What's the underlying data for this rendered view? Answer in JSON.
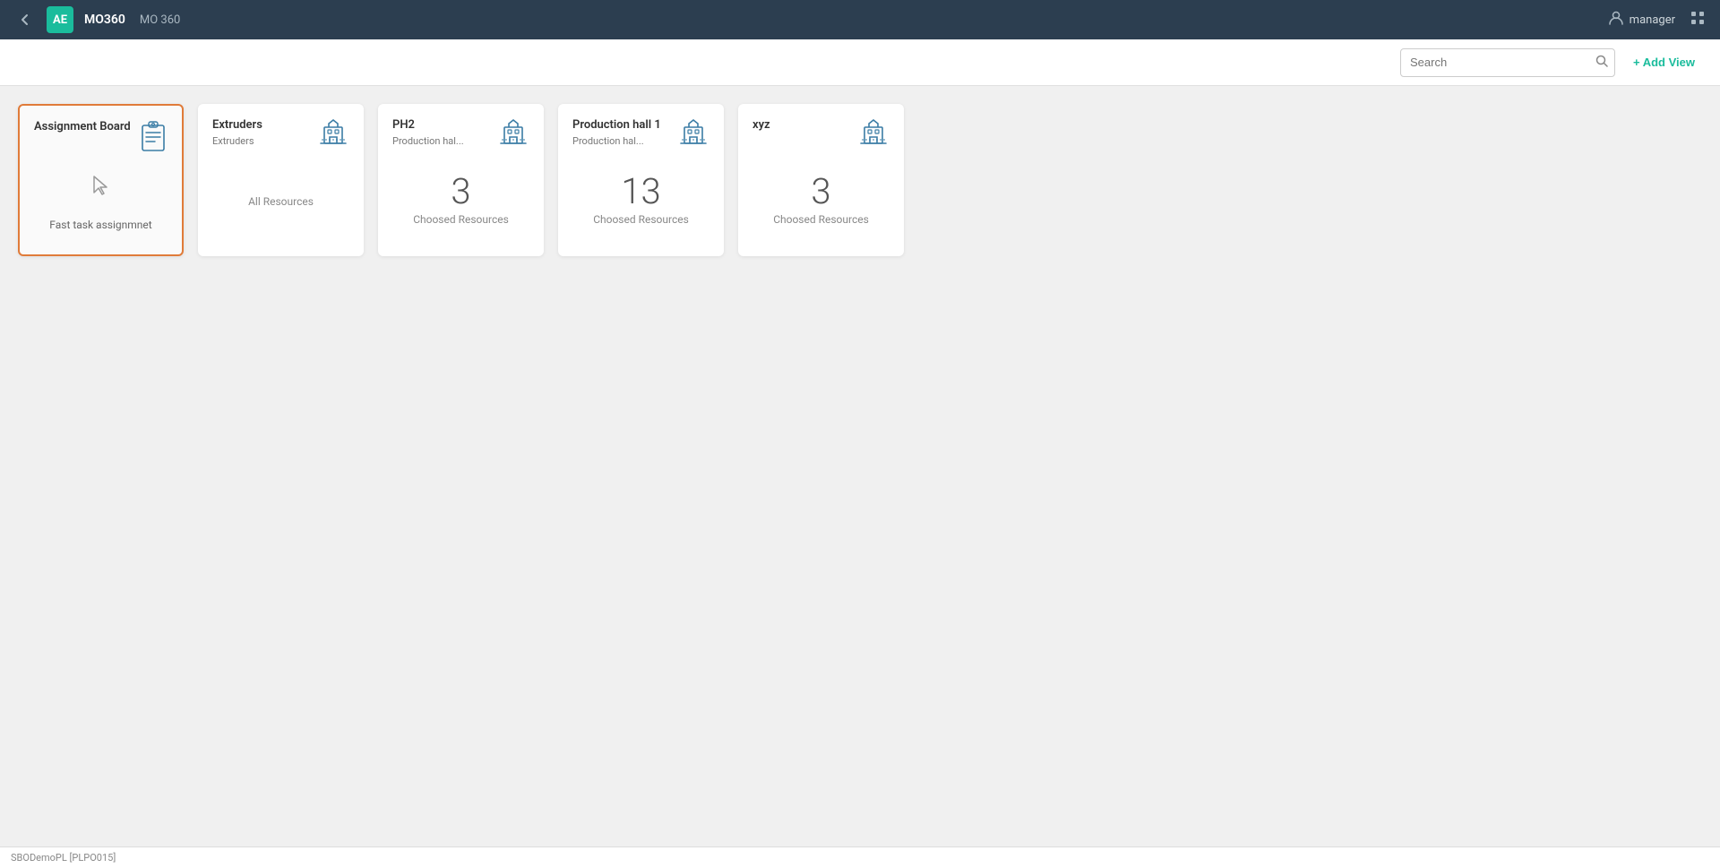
{
  "navbar": {
    "back_label": "‹",
    "logo": "AE",
    "app_name": "MO360",
    "app_subtitle": "MO 360",
    "user_name": "manager",
    "user_icon": "👤"
  },
  "toolbar": {
    "search_placeholder": "Search",
    "add_view_label": "+ Add View"
  },
  "cards": [
    {
      "id": "assignment-board",
      "title": "Assignment Board",
      "subtitle": null,
      "count": null,
      "count_label": null,
      "body_label": "Fast task assignmnet",
      "icon_type": "clipboard",
      "selected": true
    },
    {
      "id": "extruders",
      "title": "Extruders",
      "subtitle": "Extruders",
      "count": null,
      "count_label": "All Resources",
      "body_label": null,
      "icon_type": "building",
      "selected": false
    },
    {
      "id": "ph2",
      "title": "PH2",
      "subtitle": "Production hal...",
      "count": 3,
      "count_label": "Choosed Resources",
      "body_label": null,
      "icon_type": "building",
      "selected": false
    },
    {
      "id": "production-hall-1",
      "title": "Production hall 1",
      "subtitle": "Production hal...",
      "count": 13,
      "count_label": "Choosed Resources",
      "body_label": null,
      "icon_type": "building",
      "selected": false
    },
    {
      "id": "xyz",
      "title": "xyz",
      "subtitle": null,
      "count": 3,
      "count_label": "Choosed Resources",
      "body_label": null,
      "icon_type": "building",
      "selected": false
    }
  ],
  "status_bar": {
    "text": "SBODemoPL [PLPO015]"
  }
}
